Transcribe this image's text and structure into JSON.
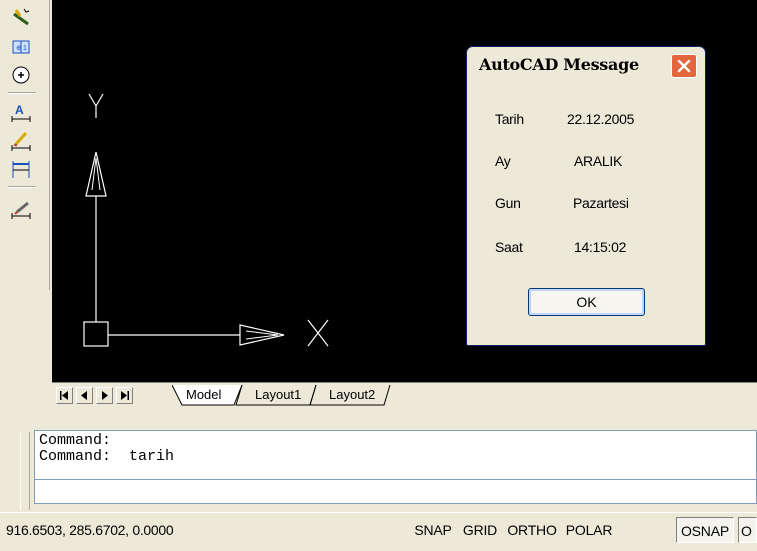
{
  "toolbar": {
    "icons": [
      "dimension-angular-icon",
      "dimension-continue-icon",
      "dimension-center-icon",
      "dimension-text-icon",
      "dimension-edit-icon",
      "dimension-linear-icon",
      "dimension-style-icon"
    ]
  },
  "canvas": {
    "background": "#000000",
    "axis_x_label": "X",
    "axis_y_label": "Y"
  },
  "tabs": {
    "model": "Model",
    "layout1": "Layout1",
    "layout2": "Layout2"
  },
  "command": {
    "lines": [
      "Command:",
      "Command:  tarih"
    ],
    "input": ""
  },
  "statusbar": {
    "coords": "916.6503, 285.6702, 0.0000",
    "snap": "SNAP",
    "grid": "GRID",
    "ortho": "ORTHO",
    "polar": "POLAR",
    "osnap": "OSNAP",
    "otrack": "O"
  },
  "dialog": {
    "title": "AutoCAD Message",
    "rows": [
      {
        "label": "Tarih",
        "value": "22.12.2005"
      },
      {
        "label": "Ay",
        "value": "ARALIK"
      },
      {
        "label": "Gun",
        "value": "Pazartesi"
      },
      {
        "label": "Saat",
        "value": "14:15:02"
      }
    ],
    "ok_label": "OK",
    "close_color": "#e3673e"
  }
}
